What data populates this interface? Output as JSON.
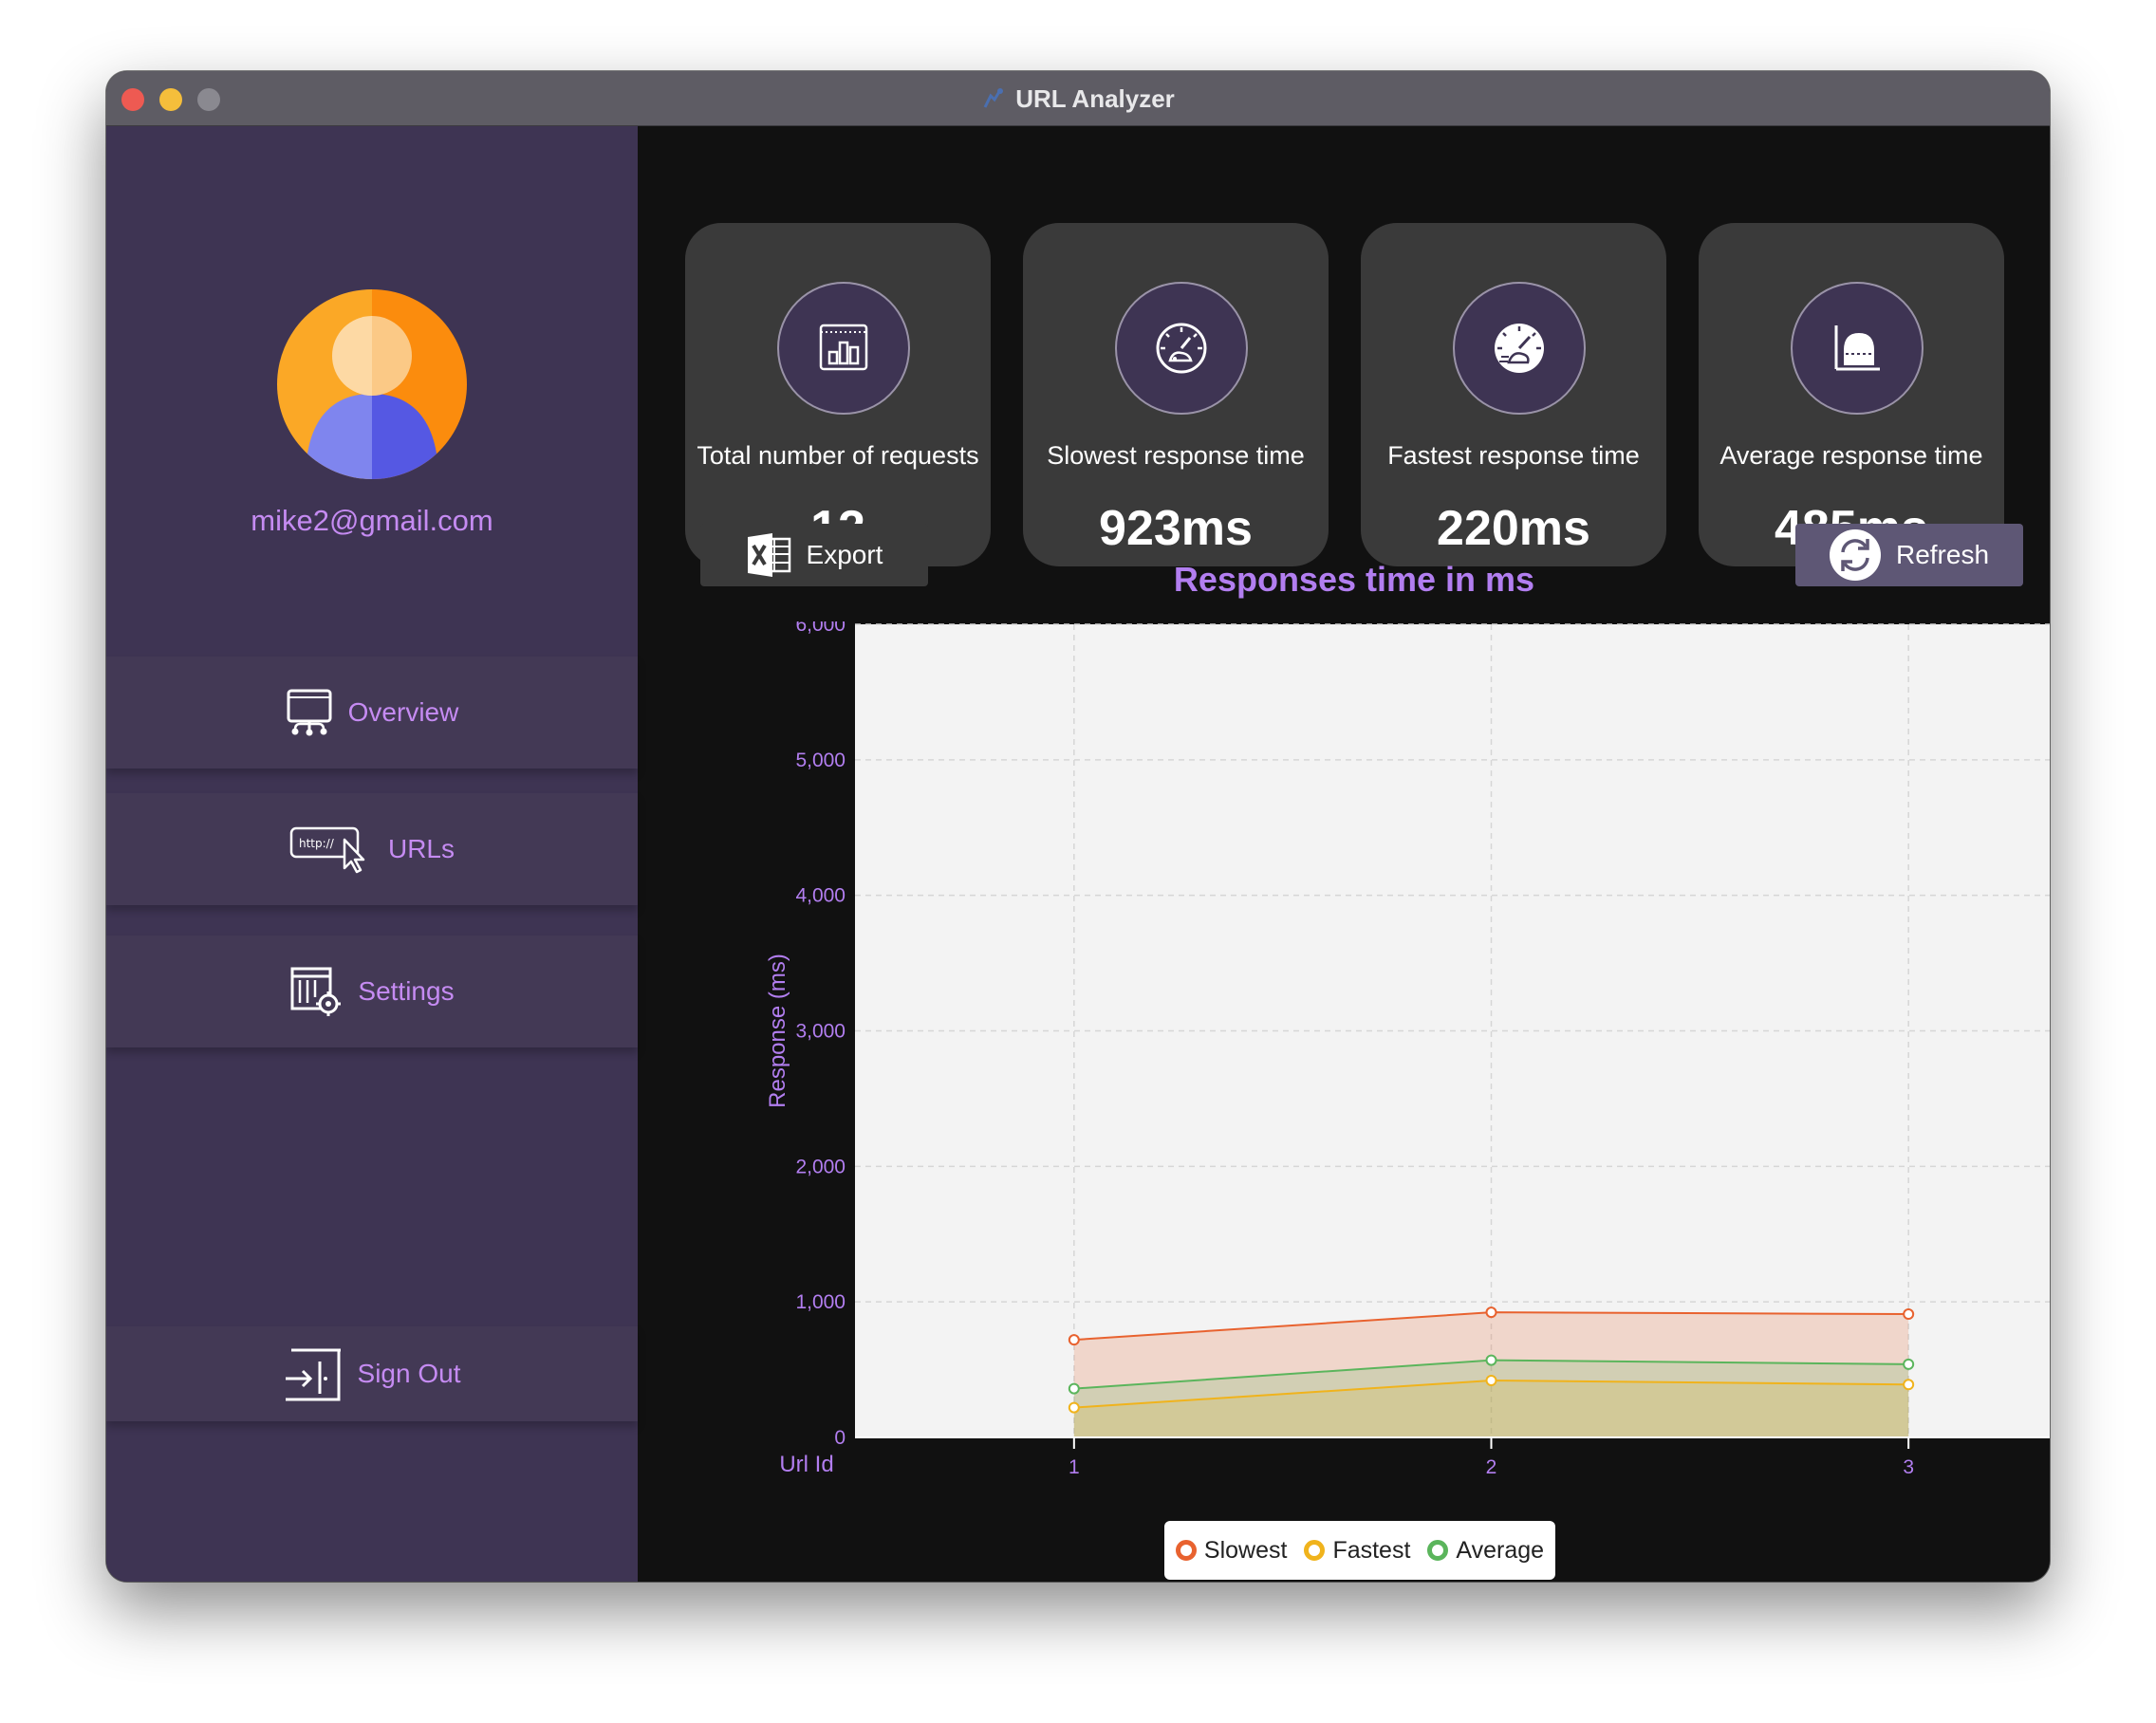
{
  "window": {
    "title": "URL Analyzer"
  },
  "sidebar": {
    "email": "mike2@gmail.com",
    "items": [
      {
        "label": "Overview",
        "icon": "monitor-network-icon"
      },
      {
        "label": "URLs",
        "icon": "http-cursor-icon"
      },
      {
        "label": "Settings",
        "icon": "calendar-gear-icon"
      },
      {
        "label": "Sign Out",
        "icon": "sign-out-icon"
      }
    ]
  },
  "stats": [
    {
      "label": "Total number of requests",
      "value": "12",
      "icon": "bar-chart-icon"
    },
    {
      "label": "Slowest response time",
      "value": "923ms",
      "icon": "speedometer-slow-icon"
    },
    {
      "label": "Fastest response time",
      "value": "220ms",
      "icon": "speedometer-fast-icon"
    },
    {
      "label": "Average response time",
      "value": "485ms",
      "icon": "average-chart-icon"
    }
  ],
  "toolbar": {
    "export_label": "Export",
    "refresh_label": "Refresh"
  },
  "colors": {
    "accent": "#c58bf2",
    "sidebar": "#3e3453",
    "slowest": "#e8622f",
    "fastest": "#f0b31c",
    "average": "#5bb55c"
  },
  "chart_data": {
    "type": "area",
    "title": "Responses time in ms",
    "xlabel": "Url Id",
    "ylabel": "Response  (ms)",
    "x": [
      1,
      2,
      3
    ],
    "x_ticks": [
      "1",
      "2",
      "3"
    ],
    "xlim": [
      0.475,
      3.525
    ],
    "ylim": [
      0,
      6000
    ],
    "y_ticks": [
      "0",
      "1,000",
      "2,000",
      "3,000",
      "4,000",
      "5,000",
      "6,000"
    ],
    "grid": true,
    "legend_position": "bottom-center",
    "series": [
      {
        "name": "Slowest",
        "values": [
          720,
          923,
          910
        ]
      },
      {
        "name": "Fastest",
        "values": [
          220,
          420,
          390
        ]
      },
      {
        "name": "Average",
        "values": [
          360,
          570,
          540
        ]
      }
    ]
  }
}
